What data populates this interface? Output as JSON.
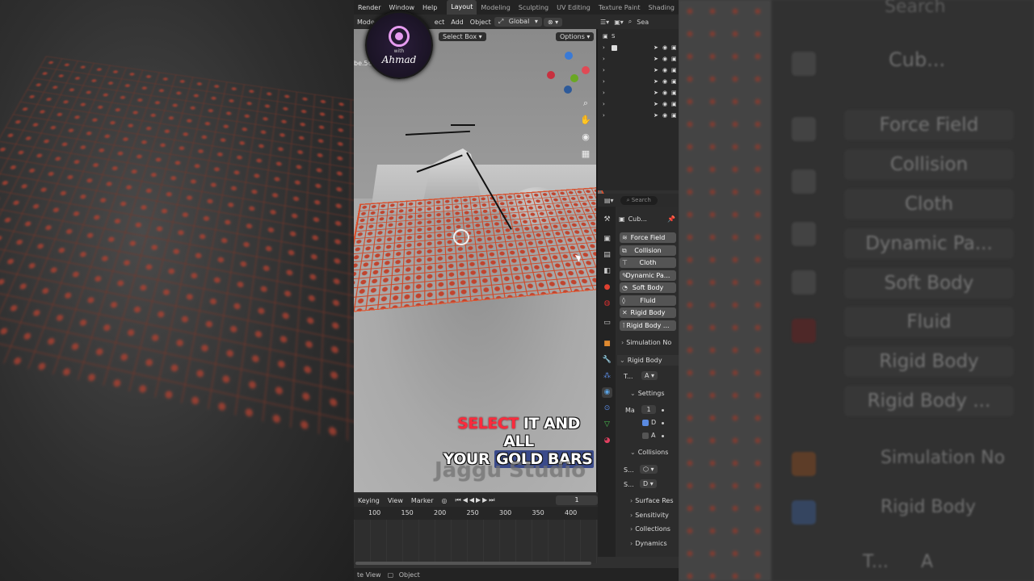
{
  "topbar": {
    "menus": [
      "Render",
      "Window",
      "Help"
    ],
    "workspaces": [
      "Layout",
      "Modeling",
      "Sculpting",
      "UV Editing",
      "Texture Paint",
      "Shading"
    ],
    "active_workspace": "Layout"
  },
  "viewport_header": {
    "mode": "Mode",
    "menus": [
      "ect",
      "Add",
      "Object"
    ],
    "transform": "Global",
    "select_tool": "Select Box",
    "options": "Options",
    "search": "Sea",
    "fragment": "be.56"
  },
  "logo": {
    "small_text": "with",
    "name": "Ahmad"
  },
  "caption": {
    "highlight": "SELECT",
    "line1_rest": "IT AND ALL",
    "line2_a": "YOUR",
    "line2_b": "GOLD BARS"
  },
  "watermark": "Jaggu Studio",
  "outliner": {
    "first_label": "S",
    "row_count": 8
  },
  "properties": {
    "search_placeholder": "Search",
    "object_name": "Cub...",
    "physics_buttons": [
      {
        "icon": "force-field-icon",
        "label": "Force Field"
      },
      {
        "icon": "collision-icon",
        "label": "Collision"
      },
      {
        "icon": "cloth-icon",
        "label": "Cloth"
      },
      {
        "icon": "dynamic-paint-icon",
        "label": "Dynamic Pa..."
      },
      {
        "icon": "soft-body-icon",
        "label": "Soft Body"
      },
      {
        "icon": "fluid-icon",
        "label": "Fluid"
      },
      {
        "icon": "close-icon",
        "label": "Rigid Body"
      },
      {
        "icon": "rigid-body-constraint-icon",
        "label": "Rigid Body ..."
      }
    ],
    "simulation_nodes": "Simulation No",
    "rigid_body": "Rigid Body",
    "type_label": "T...",
    "type_value": "A",
    "settings": "Settings",
    "mass_label": "Ma",
    "mass_value": "1",
    "dynamic_label": "D",
    "animated_label": "A",
    "collisions": "Collisions",
    "shape_label": "S...",
    "source_label": "S...",
    "source_value": "D",
    "subsections": [
      "Surface Res",
      "Sensitivity",
      "Collections",
      "Dynamics"
    ]
  },
  "timeline": {
    "menus": [
      "Keying",
      "View",
      "Marker"
    ],
    "current_frame": "1",
    "ticks": [
      "100",
      "150",
      "200",
      "250",
      "300",
      "350",
      "400"
    ]
  },
  "statusbar": {
    "left": "te View",
    "object": "Object"
  },
  "ghost_panel": {
    "search": "Search",
    "object": "Cub...",
    "buttons": [
      "Force Field",
      "Collision",
      "Cloth",
      "Dynamic Pa...",
      "Soft Body",
      "Fluid",
      "Rigid Body",
      "Rigid Body ..."
    ],
    "simulation": "Simulation No",
    "rigid": "Rigid Body",
    "type_label": "T...",
    "type_value": "A"
  },
  "colors": {
    "accent": "#ff2a3c",
    "selection": "#d04a2a",
    "button": "#545454"
  }
}
